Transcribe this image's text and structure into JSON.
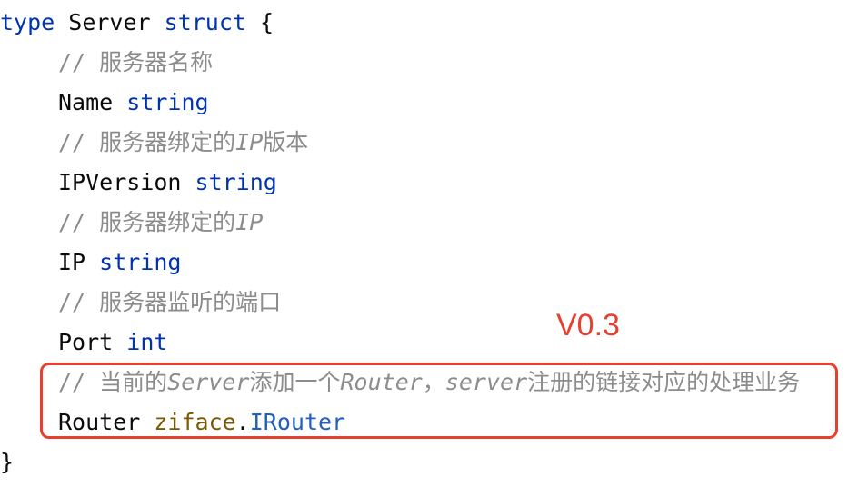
{
  "code": {
    "line1": {
      "kw1": "type",
      "name": " Server ",
      "kw2": "struct",
      "brace": " {"
    },
    "line2": {
      "comment": "// 服务器名称"
    },
    "line3": {
      "field": "Name ",
      "type": "string"
    },
    "line4": {
      "comment_pre": "// 服务器绑定的",
      "comment_it": "IP",
      "comment_post": "版本"
    },
    "line5": {
      "field": "IPVersion ",
      "type": "string"
    },
    "line6": {
      "comment_pre": "// 服务器绑定的",
      "comment_it": "IP"
    },
    "line7": {
      "field": "IP ",
      "type": "string"
    },
    "line8": {
      "comment": "// 服务器监听的端口"
    },
    "line9": {
      "field": "Port ",
      "type": "int"
    },
    "line10": {
      "c1": "// 当前的",
      "c2": "Server",
      "c3": "添加一个",
      "c4": "Router",
      "c5": "，",
      "c6": "server",
      "c7": "注册的链接对应的处理业务"
    },
    "line11": {
      "field": "Router ",
      "pkg": "ziface",
      "dot": ".",
      "iface": "IRouter"
    },
    "line12": {
      "brace": "}"
    }
  },
  "annotation": {
    "version_label": "V0.3",
    "color": "#e8402e"
  },
  "colors": {
    "keyword": "#0033b3",
    "comment": "#8c8c8c",
    "package": "#7a5a00",
    "interface": "#2060c0"
  }
}
